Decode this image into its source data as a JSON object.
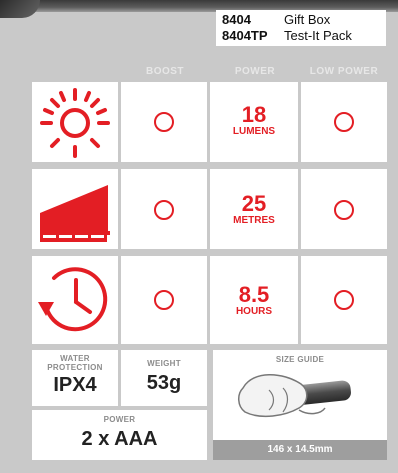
{
  "sku": [
    {
      "code": "8404",
      "name": "Gift Box"
    },
    {
      "code": "8404TP",
      "name": "Test-It Pack"
    }
  ],
  "columns": {
    "boost": "BOOST",
    "power": "POWER",
    "low_power": "LOW POWER"
  },
  "rows": [
    {
      "icon": "brightness-sun-icon",
      "value": "18",
      "unit": "LUMENS"
    },
    {
      "icon": "beam-distance-icon",
      "value": "25",
      "unit": "METRES"
    },
    {
      "icon": "runtime-clock-icon",
      "value": "8.5",
      "unit": "HOURS"
    }
  ],
  "specs": {
    "water_label": "WATER\nPROTECTION",
    "water_value": "IPX4",
    "weight_label": "WEIGHT",
    "weight_value": "53g",
    "power_label": "POWER",
    "power_value": "2 x AAA",
    "size_label": "SIZE GUIDE",
    "size_value": "146 x 14.5mm"
  },
  "colors": {
    "accent": "#e31e24",
    "background": "#c9c9c9",
    "panel": "#ffffff",
    "size_bar": "#9e9e9e"
  }
}
